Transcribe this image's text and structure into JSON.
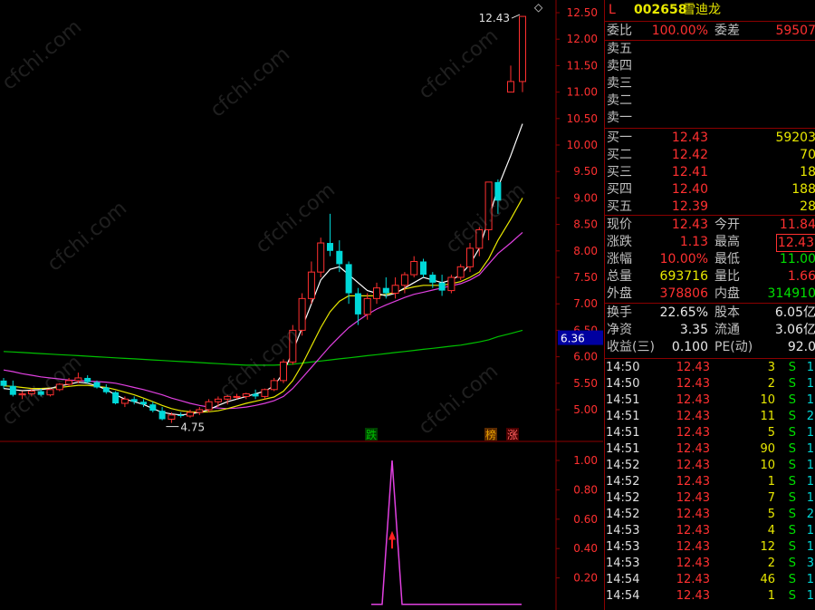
{
  "header": {
    "market": "L",
    "code": "002658",
    "name": "雪迪龙",
    "diamond": "◇"
  },
  "quote_top": {
    "weibi_label": "委比",
    "weibi_value": "100.00%",
    "weicha_label": "委差",
    "weicha_value": "59507"
  },
  "asks": [
    {
      "label": "卖五",
      "price": "",
      "vol": ""
    },
    {
      "label": "卖四",
      "price": "",
      "vol": ""
    },
    {
      "label": "卖三",
      "price": "",
      "vol": ""
    },
    {
      "label": "卖二",
      "price": "",
      "vol": ""
    },
    {
      "label": "卖一",
      "price": "",
      "vol": ""
    }
  ],
  "bids": [
    {
      "label": "买一",
      "price": "12.43",
      "vol": "59203"
    },
    {
      "label": "买二",
      "price": "12.42",
      "vol": "70"
    },
    {
      "label": "买三",
      "price": "12.41",
      "vol": "18"
    },
    {
      "label": "买四",
      "price": "12.40",
      "vol": "188"
    },
    {
      "label": "买五",
      "price": "12.39",
      "vol": "28"
    }
  ],
  "stats": [
    {
      "l1": "现价",
      "v1": "12.43",
      "c1": "red",
      "l2": "今开",
      "v2": "11.84",
      "c2": "red",
      "boxed": false
    },
    {
      "l1": "涨跌",
      "v1": "1.13",
      "c1": "red",
      "l2": "最高",
      "v2": "12.43",
      "c2": "red",
      "boxed": true
    },
    {
      "l1": "涨幅",
      "v1": "10.00%",
      "c1": "red",
      "l2": "最低",
      "v2": "11.00",
      "c2": "green",
      "boxed": false
    },
    {
      "l1": "总量",
      "v1": "693716",
      "c1": "yellow",
      "l2": "量比",
      "v2": "1.66",
      "c2": "red",
      "boxed": false
    },
    {
      "l1": "外盘",
      "v1": "378806",
      "c1": "red",
      "l2": "内盘",
      "v2": "314910",
      "c2": "green",
      "boxed": false
    }
  ],
  "fundamentals": [
    {
      "l1": "换手",
      "v1": "22.65%",
      "l2": "股本",
      "v2": "6.05亿"
    },
    {
      "l1": "净资",
      "v1": "3.35",
      "l2": "流通",
      "v2": "3.06亿"
    },
    {
      "l1": "收益(三)",
      "v1": "0.100",
      "l2": "PE(动)",
      "v2": "92.0"
    }
  ],
  "ticks": [
    {
      "time": "14:50",
      "price": "12.43",
      "vol": "3",
      "bs": "S",
      "num": "1"
    },
    {
      "time": "14:50",
      "price": "12.43",
      "vol": "2",
      "bs": "S",
      "num": "1"
    },
    {
      "time": "14:51",
      "price": "12.43",
      "vol": "10",
      "bs": "S",
      "num": "1"
    },
    {
      "time": "14:51",
      "price": "12.43",
      "vol": "11",
      "bs": "S",
      "num": "2"
    },
    {
      "time": "14:51",
      "price": "12.43",
      "vol": "5",
      "bs": "S",
      "num": "1"
    },
    {
      "time": "14:51",
      "price": "12.43",
      "vol": "90",
      "bs": "S",
      "num": "1"
    },
    {
      "time": "14:52",
      "price": "12.43",
      "vol": "10",
      "bs": "S",
      "num": "1"
    },
    {
      "time": "14:52",
      "price": "12.43",
      "vol": "1",
      "bs": "S",
      "num": "1"
    },
    {
      "time": "14:52",
      "price": "12.43",
      "vol": "7",
      "bs": "S",
      "num": "1"
    },
    {
      "time": "14:52",
      "price": "12.43",
      "vol": "5",
      "bs": "S",
      "num": "2"
    },
    {
      "time": "14:53",
      "price": "12.43",
      "vol": "4",
      "bs": "S",
      "num": "1"
    },
    {
      "time": "14:53",
      "price": "12.43",
      "vol": "12",
      "bs": "S",
      "num": "1"
    },
    {
      "time": "14:53",
      "price": "12.43",
      "vol": "2",
      "bs": "S",
      "num": "3"
    },
    {
      "time": "14:54",
      "price": "12.43",
      "vol": "46",
      "bs": "S",
      "num": "1"
    },
    {
      "time": "14:54",
      "price": "12.43",
      "vol": "1",
      "bs": "S",
      "num": "1"
    }
  ],
  "chart": {
    "price_ticks": [
      "12.50",
      "12.00",
      "11.50",
      "11.00",
      "10.50",
      "10.00",
      "9.50",
      "9.00",
      "8.50",
      "8.00",
      "7.50",
      "7.00",
      "6.50",
      "6.00",
      "5.50",
      "5.00"
    ],
    "price_values": [
      12.5,
      12.0,
      11.5,
      11.0,
      10.5,
      10.0,
      9.5,
      9.0,
      8.5,
      8.0,
      7.5,
      7.0,
      6.5,
      6.0,
      5.5,
      5.0
    ],
    "indicator_ticks": [
      "1.00",
      "0.80",
      "0.60",
      "0.40",
      "0.20"
    ],
    "current_price_tag": "6.36",
    "current_price_value": 6.36,
    "high_label": "12.43",
    "low_label": "4.75",
    "signal_labels": [
      "跌",
      "榜",
      "涨"
    ],
    "colors": {
      "up": "#ff3030",
      "down": "#00d8d8",
      "ma1": "#ffffff",
      "ma2": "#e8e800",
      "ma3": "#e040e0",
      "ma4": "#00c000",
      "grid": "#8b0000"
    },
    "candles": [
      [
        5.55,
        5.6,
        5.4,
        5.45
      ],
      [
        5.45,
        5.55,
        5.25,
        5.28
      ],
      [
        5.28,
        5.35,
        5.2,
        5.3
      ],
      [
        5.3,
        5.4,
        5.25,
        5.35
      ],
      [
        5.35,
        5.4,
        5.25,
        5.28
      ],
      [
        5.28,
        5.4,
        5.25,
        5.38
      ],
      [
        5.38,
        5.5,
        5.35,
        5.48
      ],
      [
        5.48,
        5.6,
        5.45,
        5.55
      ],
      [
        5.55,
        5.7,
        5.5,
        5.6
      ],
      [
        5.6,
        5.65,
        5.5,
        5.52
      ],
      [
        5.52,
        5.55,
        5.4,
        5.42
      ],
      [
        5.42,
        5.48,
        5.3,
        5.33
      ],
      [
        5.33,
        5.35,
        5.1,
        5.12
      ],
      [
        5.12,
        5.25,
        5.05,
        5.2
      ],
      [
        5.2,
        5.25,
        5.1,
        5.15
      ],
      [
        5.15,
        5.2,
        5.05,
        5.1
      ],
      [
        5.1,
        5.15,
        4.95,
        4.98
      ],
      [
        4.98,
        5.05,
        4.8,
        4.82
      ],
      [
        4.82,
        4.95,
        4.75,
        4.9
      ],
      [
        4.9,
        4.95,
        4.85,
        4.88
      ],
      [
        4.88,
        5.0,
        4.85,
        4.95
      ],
      [
        4.95,
        5.05,
        4.9,
        5.0
      ],
      [
        5.0,
        5.2,
        4.95,
        5.15
      ],
      [
        5.15,
        5.25,
        5.05,
        5.2
      ],
      [
        5.2,
        5.28,
        5.1,
        5.25
      ],
      [
        5.25,
        5.3,
        5.2,
        5.25
      ],
      [
        5.25,
        5.32,
        5.2,
        5.3
      ],
      [
        5.3,
        5.38,
        5.2,
        5.25
      ],
      [
        5.25,
        5.4,
        5.2,
        5.38
      ],
      [
        5.38,
        5.6,
        5.35,
        5.55
      ],
      [
        5.55,
        5.95,
        5.5,
        5.9
      ],
      [
        5.9,
        6.6,
        5.85,
        6.5
      ],
      [
        6.5,
        7.2,
        6.4,
        7.1
      ],
      [
        7.1,
        7.8,
        7.0,
        7.6
      ],
      [
        7.6,
        8.25,
        7.5,
        8.15
      ],
      [
        8.15,
        8.7,
        7.9,
        8.0
      ],
      [
        8.0,
        8.2,
        7.6,
        7.75
      ],
      [
        7.75,
        7.8,
        7.0,
        7.2
      ],
      [
        7.2,
        7.3,
        6.6,
        6.8
      ],
      [
        6.8,
        7.2,
        6.7,
        7.1
      ],
      [
        7.1,
        7.4,
        7.0,
        7.3
      ],
      [
        7.3,
        7.5,
        7.1,
        7.2
      ],
      [
        7.2,
        7.5,
        7.1,
        7.35
      ],
      [
        7.35,
        7.6,
        7.2,
        7.55
      ],
      [
        7.55,
        7.9,
        7.5,
        7.8
      ],
      [
        7.8,
        7.85,
        7.5,
        7.55
      ],
      [
        7.55,
        7.6,
        7.3,
        7.4
      ],
      [
        7.4,
        7.55,
        7.15,
        7.25
      ],
      [
        7.25,
        7.55,
        7.2,
        7.5
      ],
      [
        7.5,
        7.75,
        7.45,
        7.7
      ],
      [
        7.7,
        8.15,
        7.6,
        8.05
      ],
      [
        8.05,
        8.45,
        7.9,
        8.4
      ],
      [
        8.4,
        9.3,
        8.2,
        9.3
      ],
      [
        9.3,
        9.35,
        8.7,
        8.95
      ],
      [
        11.0,
        11.5,
        11.0,
        11.2
      ],
      [
        11.2,
        12.43,
        11.0,
        12.43
      ]
    ],
    "mas": {
      "ma1": [
        5.4,
        5.38,
        5.36,
        5.37,
        5.38,
        5.4,
        5.45,
        5.48,
        5.52,
        5.5,
        5.45,
        5.38,
        5.28,
        5.2,
        5.15,
        5.1,
        5.02,
        4.95,
        4.92,
        4.9,
        4.92,
        4.95,
        5.0,
        5.08,
        5.15,
        5.2,
        5.25,
        5.3,
        5.35,
        5.45,
        5.7,
        6.1,
        6.55,
        7.0,
        7.45,
        7.65,
        7.7,
        7.55,
        7.4,
        7.25,
        7.2,
        7.15,
        7.2,
        7.3,
        7.4,
        7.5,
        7.45,
        7.4,
        7.45,
        7.55,
        7.75,
        8.05,
        8.6,
        9.2,
        9.8,
        10.4
      ],
      "ma2": [
        5.45,
        5.44,
        5.42,
        5.4,
        5.4,
        5.41,
        5.42,
        5.44,
        5.46,
        5.46,
        5.44,
        5.42,
        5.38,
        5.33,
        5.28,
        5.22,
        5.15,
        5.08,
        5.02,
        4.98,
        4.96,
        4.95,
        4.96,
        4.98,
        5.02,
        5.07,
        5.12,
        5.16,
        5.2,
        5.24,
        5.35,
        5.55,
        5.85,
        6.2,
        6.55,
        6.85,
        7.05,
        7.15,
        7.15,
        7.15,
        7.15,
        7.18,
        7.22,
        7.28,
        7.32,
        7.35,
        7.35,
        7.35,
        7.38,
        7.42,
        7.5,
        7.6,
        7.85,
        8.2,
        8.6,
        9.0
      ],
      "ma3": [
        5.75,
        5.72,
        5.68,
        5.65,
        5.62,
        5.6,
        5.58,
        5.56,
        5.55,
        5.54,
        5.53,
        5.52,
        5.5,
        5.46,
        5.42,
        5.38,
        5.33,
        5.28,
        5.22,
        5.17,
        5.12,
        5.08,
        5.05,
        5.03,
        5.02,
        5.03,
        5.05,
        5.08,
        5.12,
        5.17,
        5.25,
        5.4,
        5.6,
        5.8,
        6.0,
        6.2,
        6.38,
        6.55,
        6.68,
        6.8,
        6.9,
        6.98,
        7.05,
        7.12,
        7.18,
        7.22,
        7.26,
        7.3,
        7.34,
        7.38,
        7.45,
        7.55,
        7.75,
        7.95,
        8.15,
        8.35
      ],
      "ma4": [
        6.1,
        6.09,
        6.08,
        6.07,
        6.06,
        6.05,
        6.04,
        6.03,
        6.02,
        6.01,
        6.0,
        5.99,
        5.98,
        5.97,
        5.96,
        5.95,
        5.94,
        5.93,
        5.92,
        5.91,
        5.9,
        5.89,
        5.88,
        5.87,
        5.86,
        5.85,
        5.84,
        5.84,
        5.84,
        5.84,
        5.85,
        5.86,
        5.88,
        5.9,
        5.92,
        5.94,
        5.96,
        5.98,
        6.0,
        6.02,
        6.04,
        6.06,
        6.08,
        6.1,
        6.12,
        6.14,
        6.16,
        6.18,
        6.2,
        6.22,
        6.25,
        6.28,
        6.32,
        6.38,
        6.44,
        6.5
      ]
    },
    "indicator": {
      "spike_index": 37,
      "spike_value": 1.0,
      "base_value": 0.02
    }
  }
}
